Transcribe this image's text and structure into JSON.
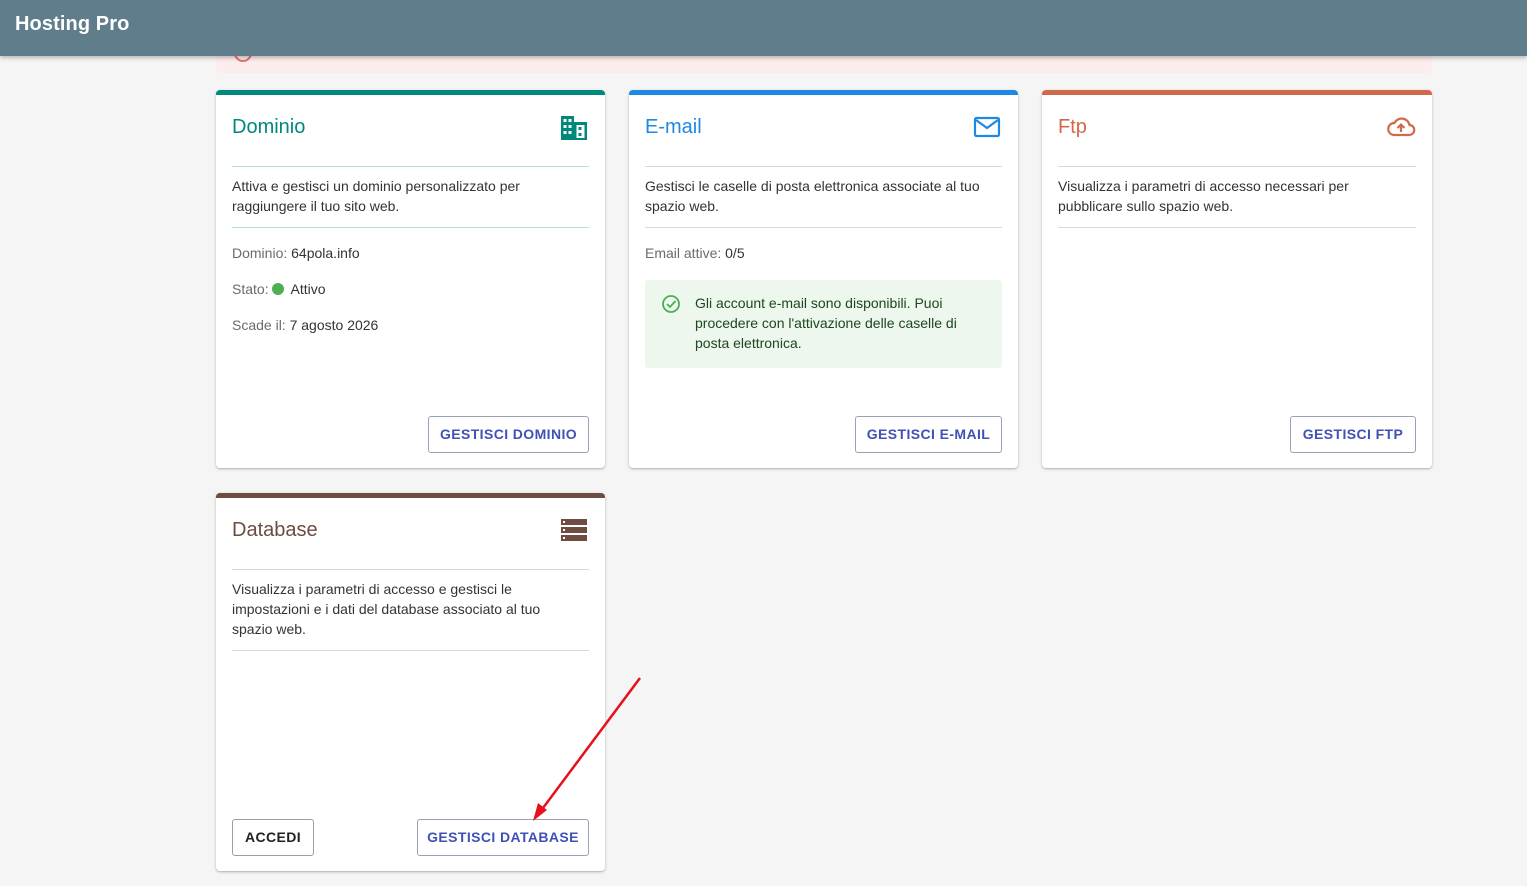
{
  "app": {
    "title": "Hosting Pro"
  },
  "colors": {
    "dominio": "#00897b",
    "email": "#1e88e5",
    "ftp": "#d1694b",
    "database": "#6d4c41",
    "button_text": "#3f51b5",
    "status_active": "#4caf50",
    "appbar": "#607d8b"
  },
  "cards": {
    "dominio": {
      "title": "Dominio",
      "icon": "domain-icon",
      "description": "Attiva e gestisci un dominio personalizzato per raggiungere il tuo sito web.",
      "fields": {
        "domain_label": "Dominio:",
        "domain_value": "64pola.info",
        "status_label": "Stato:",
        "status_value": "Attivo",
        "expiry_label": "Scade il:",
        "expiry_value": "7 agosto 2026"
      },
      "button": "GESTISCI DOMINIO"
    },
    "email": {
      "title": "E-mail",
      "icon": "mail-icon",
      "description": "Gestisci le caselle di posta elettronica associate al tuo spazio web.",
      "active_label": "Email attive:",
      "active_value": "0/5",
      "success_message": "Gli account e-mail sono disponibili. Puoi procedere con l'attivazione delle caselle di posta elettronica.",
      "button": "GESTISCI E-MAIL"
    },
    "ftp": {
      "title": "Ftp",
      "icon": "cloud-upload-icon",
      "description": "Visualizza i parametri di accesso necessari per pubblicare sullo spazio web.",
      "button": "GESTISCI FTP"
    },
    "database": {
      "title": "Database",
      "icon": "storage-icon",
      "description": "Visualizza i parametri di accesso e gestisci le impostazioni e i dati del database associato al tuo spazio web.",
      "button_access": "ACCEDI",
      "button_manage": "GESTISCI DATABASE"
    }
  }
}
